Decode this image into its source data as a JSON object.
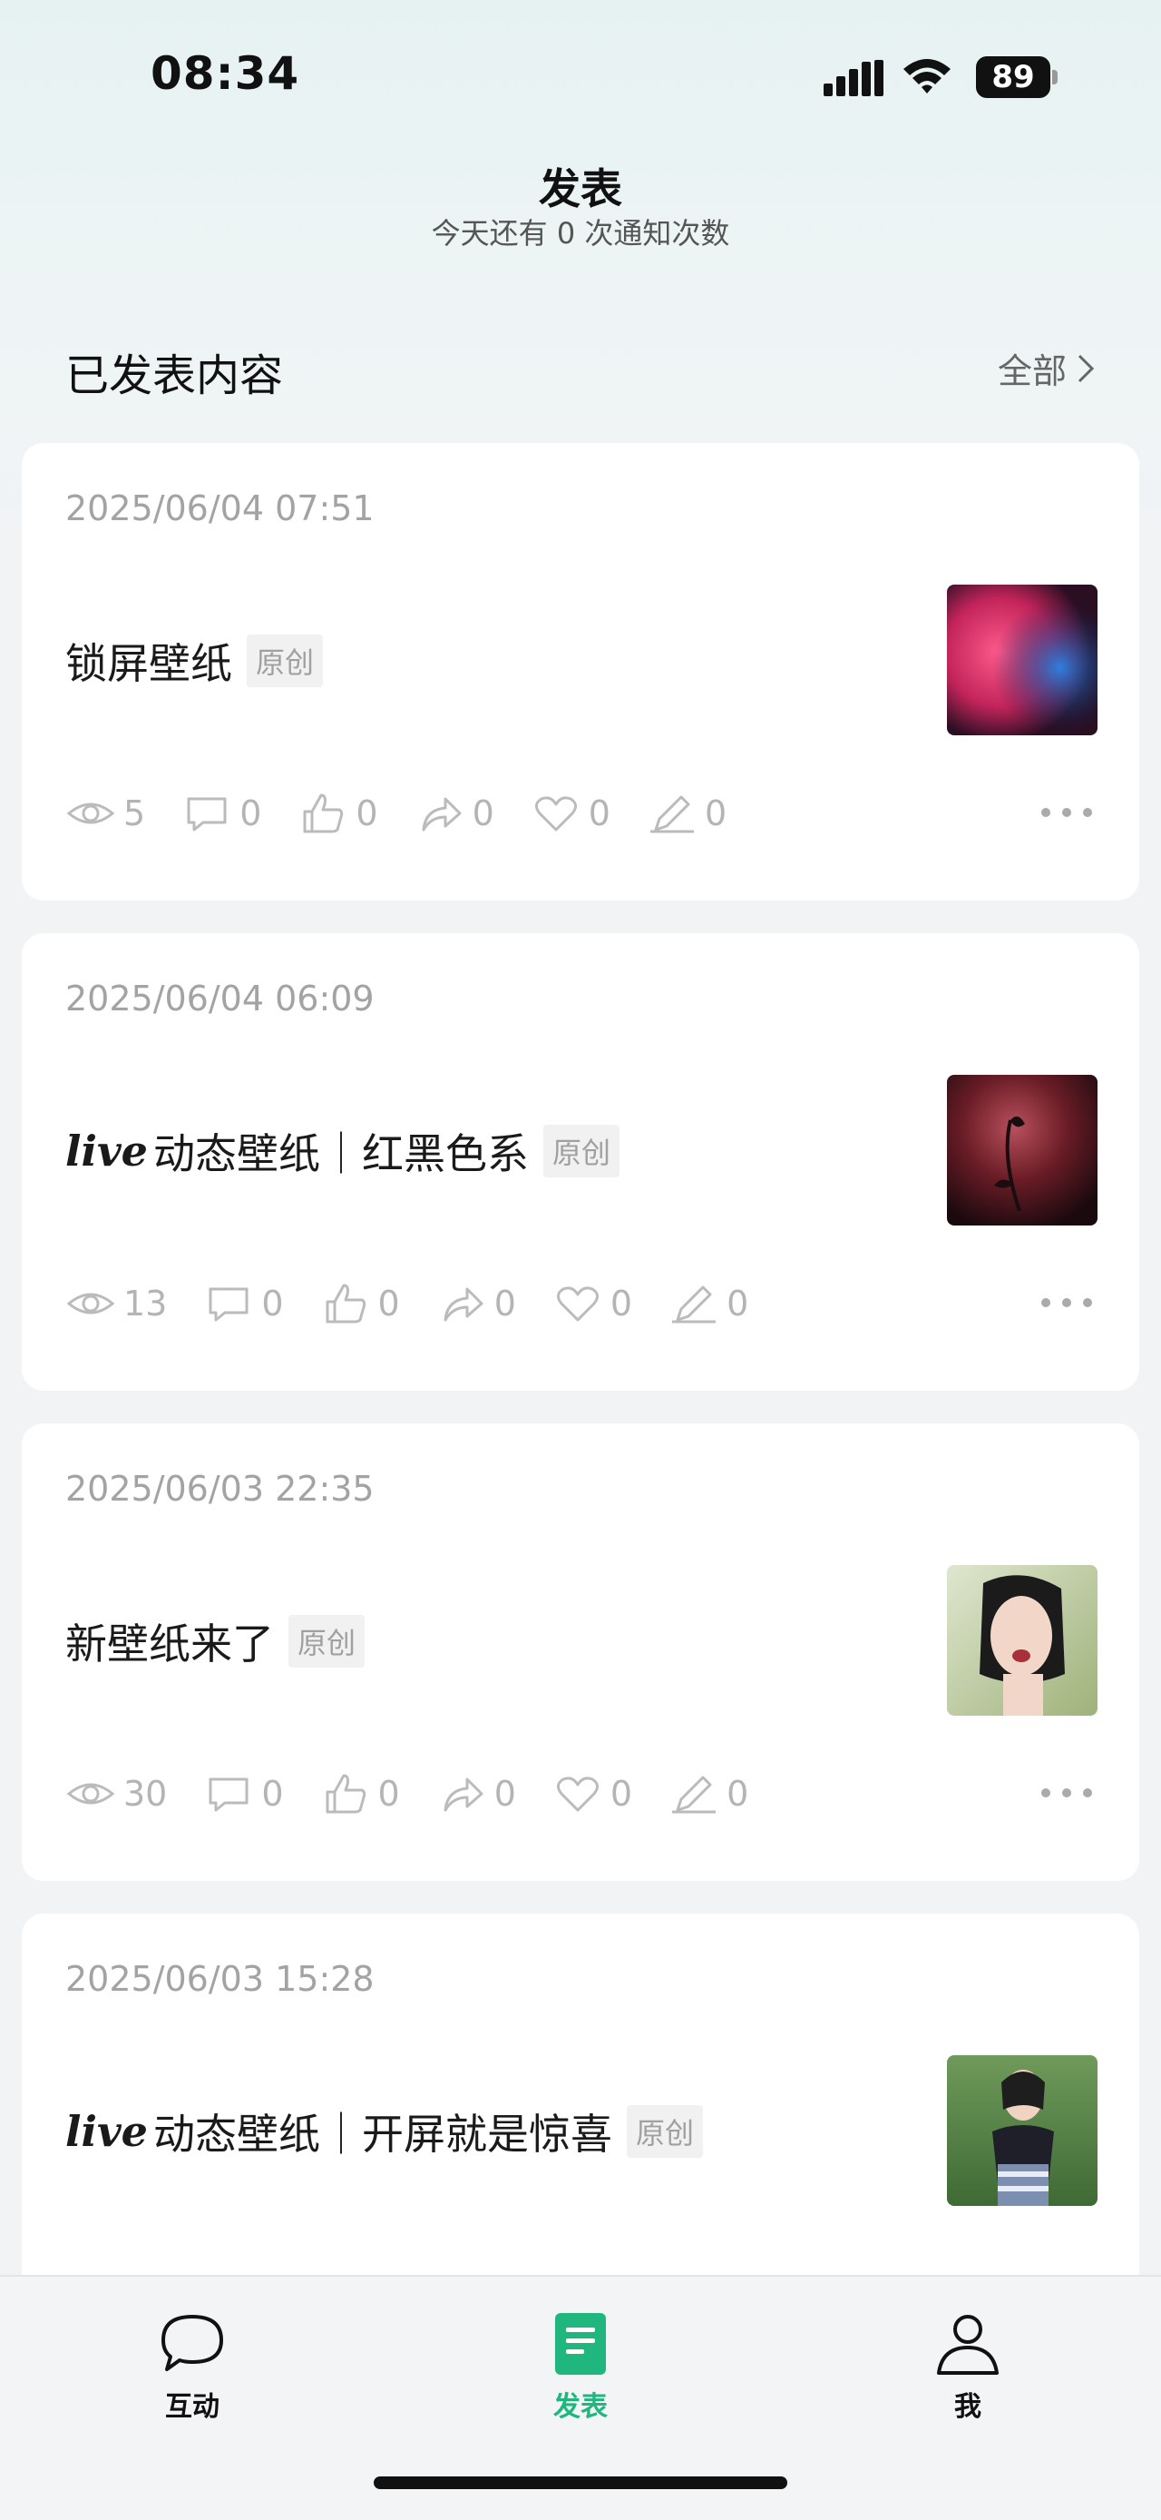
{
  "status_bar": {
    "time": "08:34",
    "battery": "89"
  },
  "header": {
    "title": "发表",
    "subtitle": "今天还有 0 次通知次数"
  },
  "section": {
    "title": "已发表内容",
    "view_all_label": "全部"
  },
  "posts": [
    {
      "date": "2025/06/04 07:51",
      "live": "",
      "title": "锁屏壁纸",
      "tag": "原创",
      "stats": {
        "views": "5",
        "comments": "0",
        "likes": "0",
        "shares": "0",
        "favorites": "0",
        "edits": "0"
      }
    },
    {
      "date": "2025/06/04 06:09",
      "live": "live",
      "title": "动态壁纸｜红黑色系",
      "tag": "原创",
      "stats": {
        "views": "13",
        "comments": "0",
        "likes": "0",
        "shares": "0",
        "favorites": "0",
        "edits": "0"
      }
    },
    {
      "date": "2025/06/03 22:35",
      "live": "",
      "title": "新壁纸来了",
      "tag": "原创",
      "stats": {
        "views": "30",
        "comments": "0",
        "likes": "0",
        "shares": "0",
        "favorites": "0",
        "edits": "0"
      }
    },
    {
      "date": "2025/06/03 15:28",
      "live": "live",
      "title": "动态壁纸｜开屏就是惊喜",
      "tag": "原创",
      "stats": {
        "views": "",
        "comments": "",
        "likes": "",
        "shares": "",
        "favorites": "",
        "edits": ""
      }
    }
  ],
  "tabbar": {
    "items": [
      {
        "label": "互动",
        "icon": "chat-bubble-icon"
      },
      {
        "label": "发表",
        "icon": "document-icon",
        "active": true
      },
      {
        "label": "我",
        "icon": "person-icon"
      }
    ]
  },
  "colors": {
    "accent": "#1fb77e",
    "muted_text": "#a3a3a3",
    "background": "#f1f3f5"
  }
}
